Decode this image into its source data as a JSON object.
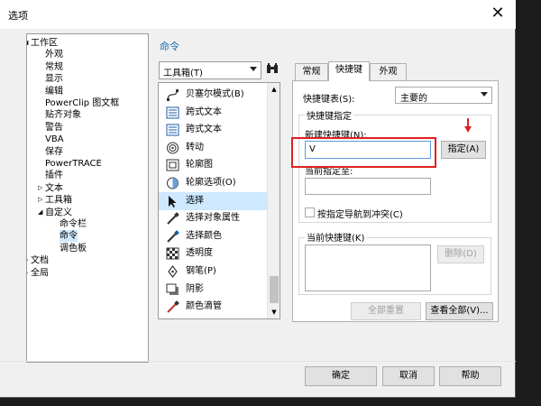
{
  "window": {
    "title": "选项",
    "close_symbol": "✕"
  },
  "tree": {
    "items": [
      {
        "label": "工作区",
        "arrow": "◢",
        "level": 0
      },
      {
        "label": "外观",
        "level": 1
      },
      {
        "label": "常规",
        "level": 1
      },
      {
        "label": "显示",
        "level": 1
      },
      {
        "label": "编辑",
        "level": 1
      },
      {
        "label": "PowerClip 图文框",
        "level": 1
      },
      {
        "label": "贴齐对象",
        "level": 1
      },
      {
        "label": "警告",
        "level": 1
      },
      {
        "label": "VBA",
        "level": 1
      },
      {
        "label": "保存",
        "level": 1
      },
      {
        "label": "PowerTRACE",
        "level": 1
      },
      {
        "label": "插件",
        "level": 1
      },
      {
        "label": "文本",
        "arrow": "▷",
        "level": 1
      },
      {
        "label": "工具箱",
        "arrow": "▷",
        "level": 1
      },
      {
        "label": "自定义",
        "arrow": "◢",
        "level": 1
      },
      {
        "label": "命令栏",
        "level": 2
      },
      {
        "label": "命令",
        "level": 2
      },
      {
        "label": "调色板",
        "level": 2
      },
      {
        "label": "文档",
        "arrow": "▷",
        "level": 0
      },
      {
        "label": "全局",
        "arrow": "▷",
        "level": 0
      }
    ]
  },
  "commands": {
    "section_title": "命令",
    "category_select": "工具箱(T)",
    "binoculars_icon": "binoculars-icon",
    "items": [
      {
        "label": "贝塞尔模式(B)",
        "icon": "bezier-icon"
      },
      {
        "label": "跨式文本",
        "icon": "text-frame-icon"
      },
      {
        "label": "跨式文本",
        "icon": "text-frame-icon"
      },
      {
        "label": "转动",
        "icon": "spiral-icon"
      },
      {
        "label": "轮廓图",
        "icon": "contour-icon"
      },
      {
        "label": "轮廓选项(O)",
        "icon": "contour-options-icon"
      },
      {
        "label": "选择",
        "icon": "pointer-icon"
      },
      {
        "label": "选择对象属性",
        "icon": "eyedropper-icon"
      },
      {
        "label": "选择颜色",
        "icon": "eyedropper-color-icon"
      },
      {
        "label": "透明度",
        "icon": "transparency-icon"
      },
      {
        "label": "钢笔(P)",
        "icon": "pen-icon"
      },
      {
        "label": "阴影",
        "icon": "shadow-icon"
      },
      {
        "label": "颜色滴管",
        "icon": "color-eyedropper-icon"
      }
    ]
  },
  "tabs": [
    "常规",
    "快捷键",
    "外观"
  ],
  "shortcut": {
    "table_label": "快捷键表(S):",
    "table_value": "主要的",
    "assign_group_label": "快捷键指定",
    "new_key_label": "新建快捷键(N):",
    "new_key_value": "V",
    "assign_button": "指定(A)",
    "current_assigned_label": "当前指定至:",
    "current_assigned_value": "",
    "nav_conflict_label": "按指定导航到冲突(C)",
    "current_keys_label": "当前快捷键(K)",
    "delete_button": "删除(D)",
    "reset_all_button": "全部重置",
    "view_all_button": "查看全部(V)..."
  },
  "footer": {
    "ok_button": "确定",
    "cancel_button": "取消",
    "help_button": "帮助"
  },
  "colors": {
    "highlight_red": "#e02020",
    "selection": "#cde8ff",
    "accent_title": "#1a6fb0"
  }
}
